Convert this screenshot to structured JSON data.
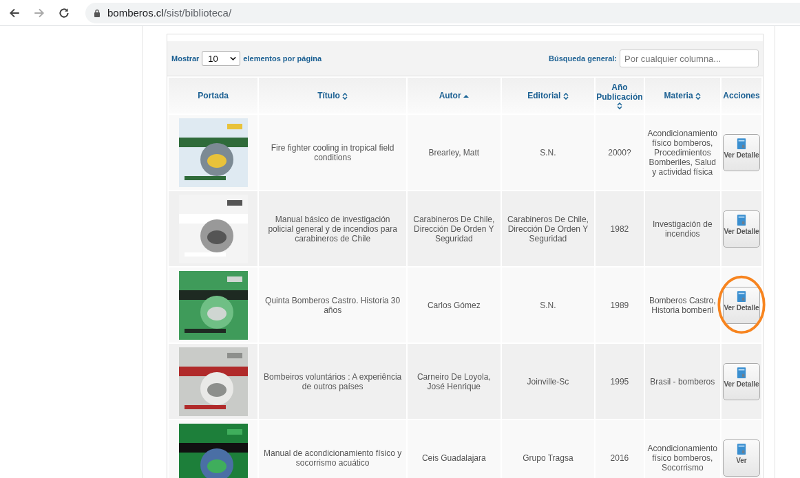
{
  "browser": {
    "url_host": "bomberos.cl",
    "url_path": "/sist/biblioteca/"
  },
  "controls": {
    "show_label": "Mostrar",
    "page_size": "10",
    "per_page_label": "elementos por página",
    "search_label": "Búsqueda general:",
    "search_placeholder": "Por cualquier columna..."
  },
  "columns": [
    {
      "label": "Portada",
      "sortable": false,
      "sorted_ascending": false
    },
    {
      "label": "Título",
      "sortable": true,
      "sorted_ascending": false
    },
    {
      "label": "Autor",
      "sortable": true,
      "sorted_ascending": true
    },
    {
      "label": "Editorial",
      "sortable": true,
      "sorted_ascending": false
    },
    {
      "label": "Año Publicación",
      "sortable": true,
      "sorted_ascending": false
    },
    {
      "label": "Materia",
      "sortable": true,
      "sorted_ascending": false
    },
    {
      "label": "Acciones",
      "sortable": false,
      "sorted_ascending": false
    }
  ],
  "rows": [
    {
      "title": "Fire fighter cooling in tropical field conditions",
      "author": "Brearley, Matt",
      "publisher": "S.N.",
      "year": "2000?",
      "subject": "Acondicionamiento físico bomberos, Procedimientos Bomberiles, Salud y actividad física",
      "action": "Ver Detalle",
      "circled": false
    },
    {
      "title": "Manual básico de investigación policial general y de incendios para carabineros de Chile",
      "author": "Carabineros De Chile, Dirección De Orden Y Seguridad",
      "publisher": "Carabineros De Chile, Dirección De Orden Y Seguridad",
      "year": "1982",
      "subject": "Investigación de incendios",
      "action": "Ver Detalle",
      "circled": false
    },
    {
      "title": "Quinta Bomberos Castro. Historia 30 años",
      "author": "Carlos Gómez",
      "publisher": "S.N.",
      "year": "1989",
      "subject": "Bomberos Castro, Historia bomberil",
      "action": "Ver Detalle",
      "circled": true
    },
    {
      "title": "Bombeiros voluntários : A experiência de outros países",
      "author": "Carneiro De Loyola, José Henrique",
      "publisher": "Joinville-Sc",
      "year": "1995",
      "subject": "Brasil - bomberos",
      "action": "Ver Detalle",
      "circled": false
    },
    {
      "title": "Manual de acondicionamiento físico y socorrismo acuático",
      "author": "Ceis Guadalajara",
      "publisher": "Grupo Tragsa",
      "year": "2016",
      "subject": "Acondicionamiento físico bomberos, Socorrismo",
      "action": "Ver",
      "circled": false
    }
  ]
}
